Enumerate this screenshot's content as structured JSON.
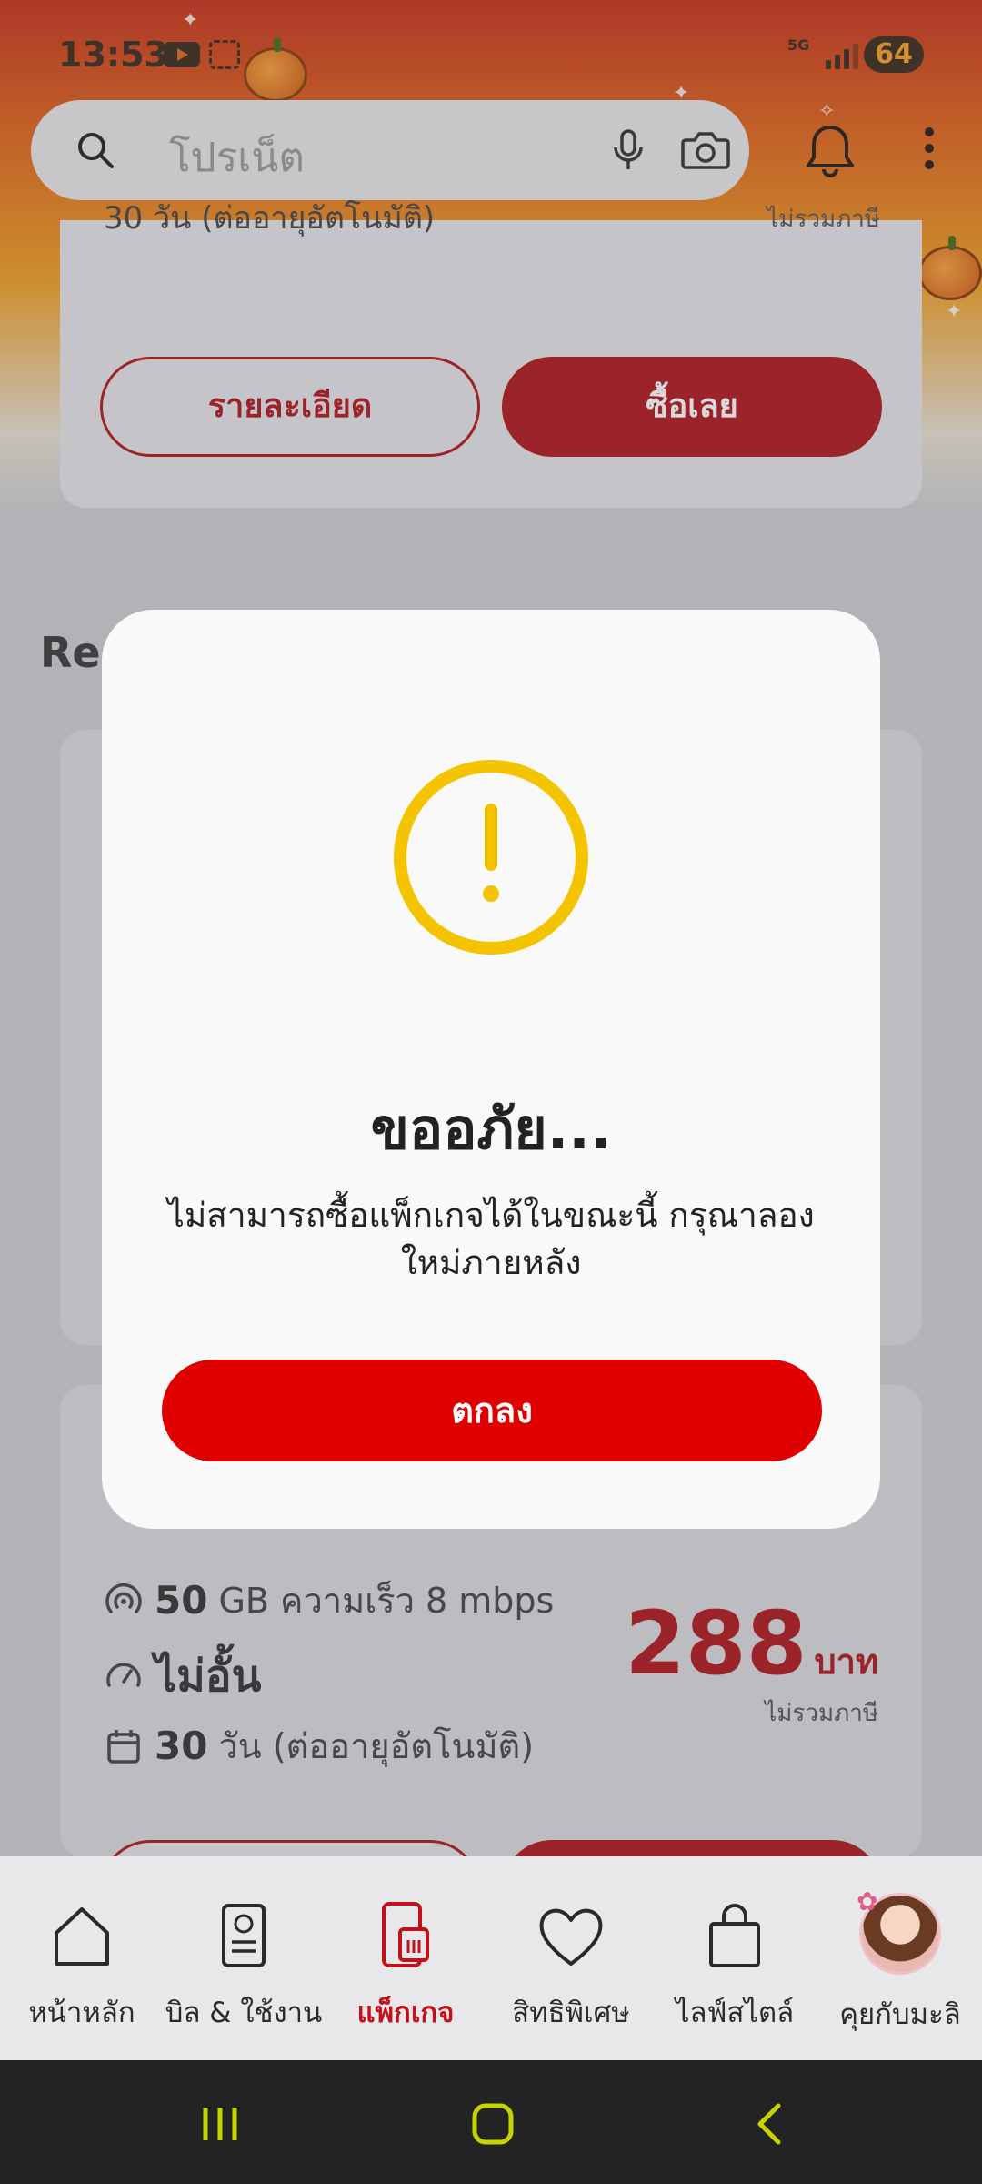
{
  "status_bar": {
    "time": "13:53",
    "network": "5G",
    "battery": "64"
  },
  "search": {
    "placeholder": "โปรเน็ต"
  },
  "top_card": {
    "partial_text": "30 วัน (ต่ออายุอัตโนมัติ)",
    "partial_tax": "ไม่รวมภาษี",
    "details_label": "รายละเอียด",
    "buy_label": "ซื้อเลย"
  },
  "section": {
    "title_partial": "Re"
  },
  "package_card": {
    "data": {
      "value": "50",
      "text": "GB ความเร็ว 8 mbps"
    },
    "speed": {
      "value": "ไม่อั้น"
    },
    "validity": {
      "value": "30",
      "text": "วัน (ต่ออายุอัตโนมัติ)"
    },
    "price": "288",
    "price_unit": "บาท",
    "tax_note": "ไม่รวมภาษี"
  },
  "dialog": {
    "title": "ขออภัย...",
    "message": "ไม่สามารถซื้อแพ็กเกจได้ในขณะนี้ กรุณาลองใหม่ภายหลัง",
    "ok_label": "ตกลง",
    "icon": "alert-circle-icon",
    "icon_color": "#F5C400",
    "button_color": "#E00000"
  },
  "bottom_nav": {
    "items": [
      {
        "label": "หน้าหลัก",
        "icon": "home-icon"
      },
      {
        "label": "บิล & ใช้งาน",
        "icon": "bill-icon"
      },
      {
        "label": "แพ็กเกจ",
        "icon": "sim-package-icon",
        "active": true
      },
      {
        "label": "สิทธิพิเศษ",
        "icon": "heart-icon"
      },
      {
        "label": "ไลฟ์สไตล์",
        "icon": "shopping-bag-icon"
      },
      {
        "label": "คุยกับมะลิ",
        "icon": "avatar"
      }
    ]
  },
  "colors": {
    "brand_red": "#B0181E",
    "active_nav": "#C0121A",
    "system_nav_icon": "#C8D400"
  }
}
